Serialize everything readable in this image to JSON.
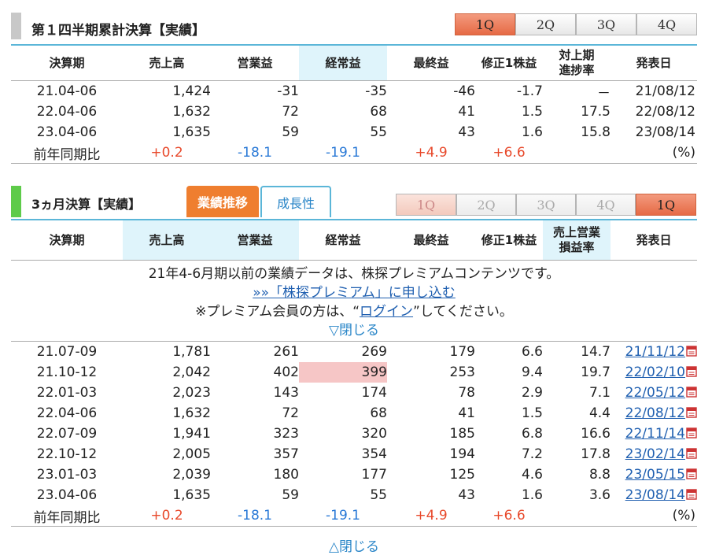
{
  "cumulative": {
    "title": "第１四半期累計決算【実績】",
    "quarter_tabs": [
      "1Q",
      "2Q",
      "3Q",
      "4Q"
    ],
    "active_tab": "1Q",
    "headers": [
      "決算期",
      "売上高",
      "営業益",
      "経常益",
      "最終益",
      "修正1株益",
      "対上期\n進捗率",
      "発表日"
    ],
    "rows": [
      [
        "21.04-06",
        "1,424",
        "-31",
        "-35",
        "-46",
        "-1.7",
        "－",
        "21/08/12"
      ],
      [
        "22.04-06",
        "1,632",
        "72",
        "68",
        "41",
        "1.5",
        "17.5",
        "22/08/12"
      ],
      [
        "23.04-06",
        "1,635",
        "59",
        "55",
        "43",
        "1.6",
        "15.8",
        "23/08/14"
      ]
    ],
    "yoy": [
      "前年同期比",
      "+0.2",
      "-18.1",
      "-19.1",
      "+4.9",
      "+6.6",
      "",
      "(%)"
    ]
  },
  "quarterly": {
    "title": "3ヵ月決算【実績】",
    "tab_performance": "業績推移",
    "tab_growth": "成長性",
    "quarter_tabs": [
      "1Q",
      "2Q",
      "3Q",
      "4Q",
      "1Q"
    ],
    "active_tab_index": 4,
    "headers": [
      "決算期",
      "売上高",
      "営業益",
      "経常益",
      "最終益",
      "修正1株益",
      "売上営業\n損益率",
      "発表日"
    ],
    "notice": {
      "line1": "21年4-6月期以前の業績データは、株探プレミアムコンテンツです。",
      "signup_link": "»»「株探プレミアム」に申し込む",
      "login_prefix": "※プレミアム会員の方は、“",
      "login_link": "ログイン",
      "login_suffix": "”してください。",
      "close_top": "▽閉じる"
    },
    "rows": [
      [
        "21.07-09",
        "1,781",
        "261",
        "269",
        "179",
        "6.6",
        "14.7",
        "21/11/12"
      ],
      [
        "21.10-12",
        "2,042",
        "402",
        "399",
        "253",
        "9.4",
        "19.7",
        "22/02/10"
      ],
      [
        "22.01-03",
        "2,023",
        "143",
        "174",
        "78",
        "2.9",
        "7.1",
        "22/05/12"
      ],
      [
        "22.04-06",
        "1,632",
        "72",
        "68",
        "41",
        "1.5",
        "4.4",
        "22/08/12"
      ],
      [
        "22.07-09",
        "1,941",
        "323",
        "320",
        "185",
        "6.8",
        "16.6",
        "22/11/14"
      ],
      [
        "22.10-12",
        "2,005",
        "357",
        "354",
        "194",
        "7.2",
        "17.8",
        "23/02/14"
      ],
      [
        "23.01-03",
        "2,039",
        "180",
        "177",
        "125",
        "4.6",
        "8.8",
        "23/05/15"
      ],
      [
        "23.04-06",
        "1,635",
        "59",
        "55",
        "43",
        "1.6",
        "3.6",
        "23/08/14"
      ]
    ],
    "yoy": [
      "前年同期比",
      "+0.2",
      "-18.1",
      "-19.1",
      "+4.9",
      "+6.6",
      "",
      "(%)"
    ],
    "close_bottom": "△閉じる"
  },
  "colors": {
    "accent_orange": "#ef7e2f",
    "header_rule": "#5bb6d8",
    "positive": "#e8492b",
    "negative": "#2878d6",
    "highlight_cell": "#f6c6c6"
  }
}
